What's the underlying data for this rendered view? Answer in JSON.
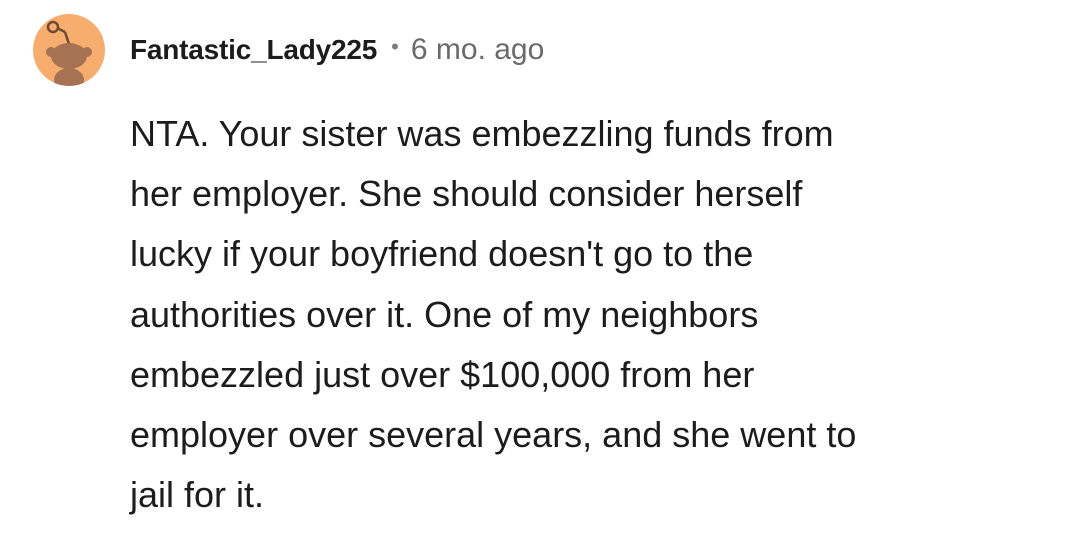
{
  "comment": {
    "author": "Fantastic_Lady225",
    "separator": "•",
    "timestamp": "6 mo. ago",
    "avatar_icon": "reddit-snoo-icon",
    "avatar_color": "#f7ad6e",
    "body_lines": [
      "NTA. Your sister was embezzling funds from",
      "her employer. She should consider herself",
      "lucky if your boyfriend doesn't go to the",
      "authorities over it. One of my neighbors",
      "embezzled just over $100,000 from her",
      "employer over several years, and she went to",
      "jail for it."
    ]
  }
}
